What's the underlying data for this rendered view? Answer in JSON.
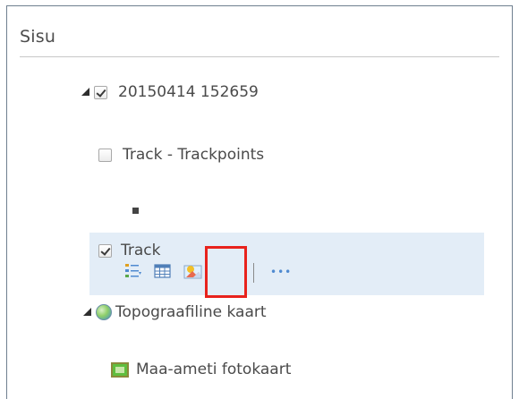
{
  "panel": {
    "title": "Sisu"
  },
  "tree": {
    "group": {
      "label": "20150414 152659",
      "checked": true,
      "expanded": true
    },
    "layer_trackpoints": {
      "label": "Track - Trackpoints",
      "checked": false
    },
    "layer_track": {
      "label": "Track",
      "checked": true,
      "tools": [
        "legend-icon",
        "table-icon",
        "image-style-icon"
      ],
      "more": "•••"
    },
    "basemap": {
      "label": "Topograafiline kaart",
      "expanded": true
    },
    "basemap_layer": {
      "label": "Maa-ameti fotokaart"
    }
  },
  "colors": {
    "highlight": "#e3edf7",
    "callout": "#e8221c",
    "border": "#6f7f8f"
  }
}
